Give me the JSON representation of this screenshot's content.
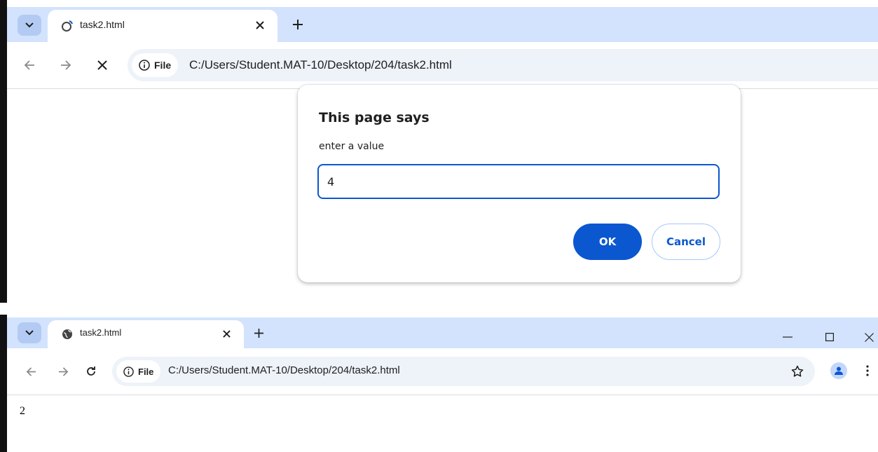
{
  "screenshot1": {
    "tab": {
      "title": "task2.html",
      "icon": "loading-globe-icon"
    },
    "address": {
      "chip_label": "File",
      "url": "C:/Users/Student.MAT-10/Desktop/204/task2.html"
    },
    "dialog": {
      "title": "This page says",
      "message": "enter a value",
      "input_value": "4",
      "ok_label": "OK",
      "cancel_label": "Cancel"
    }
  },
  "screenshot2": {
    "tab": {
      "title": "task2.html",
      "icon": "globe-icon"
    },
    "address": {
      "chip_label": "File",
      "url": "C:/Users/Student.MAT-10/Desktop/204/task2.html"
    },
    "page_output": "2"
  },
  "colors": {
    "accent": "#0b57d0",
    "tabstrip": "#d3e3fd",
    "omnibox": "#eef2f9"
  }
}
